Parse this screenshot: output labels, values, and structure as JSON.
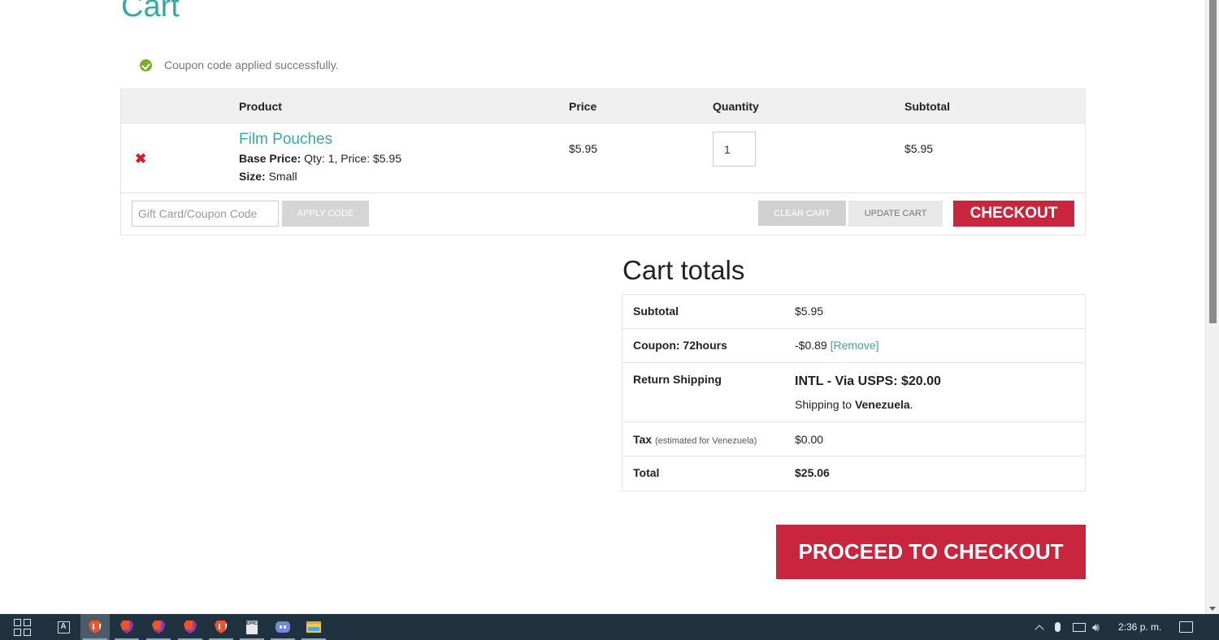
{
  "page": {
    "title": "Cart"
  },
  "notice": {
    "text": "Coupon code applied successfully."
  },
  "cart": {
    "headers": {
      "product": "Product",
      "price": "Price",
      "quantity": "Quantity",
      "subtotal": "Subtotal"
    },
    "items": [
      {
        "name": "Film Pouches",
        "meta": [
          {
            "label": "Base Price:",
            "value": " Qty: 1, Price: $5.95"
          },
          {
            "label": "Size:",
            "value": " Small"
          }
        ],
        "price": "$5.95",
        "quantity": "1",
        "subtotal": "$5.95"
      }
    ],
    "coupon_placeholder": "Gift Card/Coupon Code",
    "apply_label": "APPLY CODE",
    "clear_label": "CLEAR CART",
    "update_label": "UPDATE CART",
    "checkout_label": "CHECKOUT"
  },
  "totals": {
    "title": "Cart totals",
    "subtotal": {
      "label": "Subtotal",
      "value": "$5.95"
    },
    "coupon": {
      "label": "Coupon: 72hours",
      "value": "-$0.89",
      "remove": "[Remove]"
    },
    "shipping": {
      "label": "Return Shipping",
      "method": "INTL - Via USPS: $20.00",
      "dest_prefix": "Shipping to ",
      "dest": "Venezuela",
      "dest_suffix": "."
    },
    "tax": {
      "label": "Tax",
      "note": "(estimated for Venezuela)",
      "value": "$0.00"
    },
    "total": {
      "label": "Total",
      "value": "$25.06"
    }
  },
  "proceed_label": "PROCEED TO CHECKOUT",
  "taskbar": {
    "clock": "2:36 p. m.",
    "apps": [
      "task-view-icon",
      "keyboard-a-icon",
      "brave-icon",
      "brave-profile-icon",
      "brave-profile-icon",
      "brave-profile-icon",
      "brave-icon",
      "epic-games-icon",
      "discord-icon",
      "file-explorer-icon"
    ],
    "epic_text": "EPIC"
  },
  "colors": {
    "accent": "#3aa7a0",
    "checkout": "#c8263f",
    "success": "#7bab2a",
    "remove": "#d21f2a",
    "taskbar": "#20313f"
  }
}
